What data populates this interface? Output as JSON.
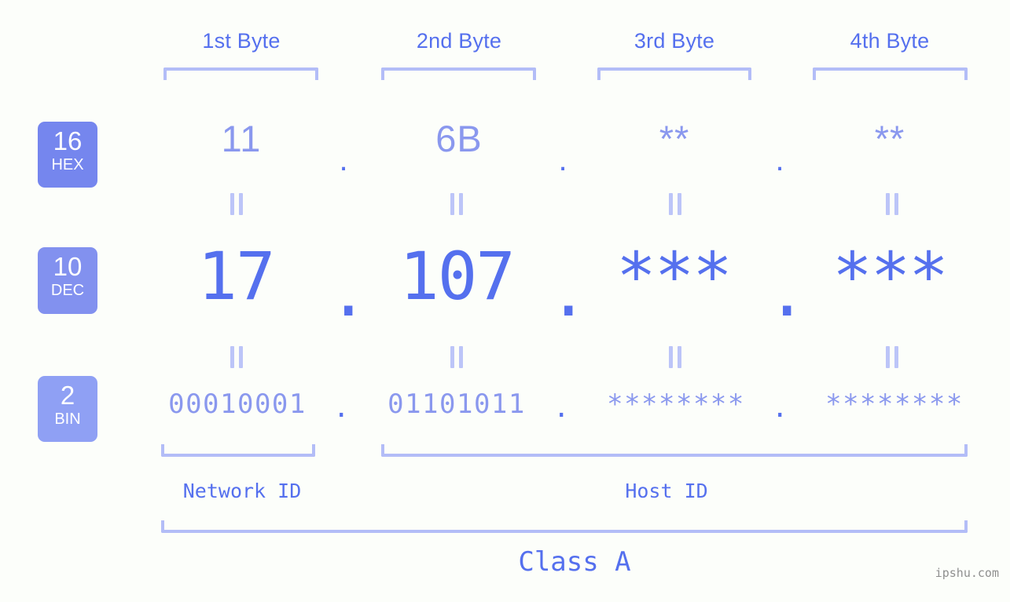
{
  "diagram": {
    "title": "IPv4 address byte breakdown",
    "background_color": "#fcfefa",
    "accent_color": "#5570ee",
    "accent_light_color": "#8a98ee",
    "bracket_color": "#b3bdf7",
    "badge_color": "#7c8cee"
  },
  "byte_headers": [
    {
      "label": "1st Byte"
    },
    {
      "label": "2nd Byte"
    },
    {
      "label": "3rd Byte"
    },
    {
      "label": "4th Byte"
    }
  ],
  "bases": [
    {
      "number": "16",
      "name": "HEX"
    },
    {
      "number": "10",
      "name": "DEC"
    },
    {
      "number": "2",
      "name": "BIN"
    }
  ],
  "rows": {
    "hex": {
      "base_number": "16",
      "base_name": "HEX",
      "values": [
        "11",
        "6B",
        "**",
        "**"
      ],
      "separators": [
        ".",
        ".",
        "."
      ]
    },
    "dec": {
      "base_number": "10",
      "base_name": "DEC",
      "values": [
        "17",
        "107",
        "***",
        "***"
      ],
      "separators": [
        ".",
        ".",
        "."
      ]
    },
    "bin": {
      "base_number": "2",
      "base_name": "BIN",
      "values": [
        "00010001",
        "01101011",
        "********",
        "********"
      ],
      "separators": [
        ".",
        ".",
        "."
      ]
    }
  },
  "id_sections": [
    {
      "label": "Network ID"
    },
    {
      "label": "Host ID"
    }
  ],
  "class_label": "Class A",
  "watermark": "ipshu.com"
}
